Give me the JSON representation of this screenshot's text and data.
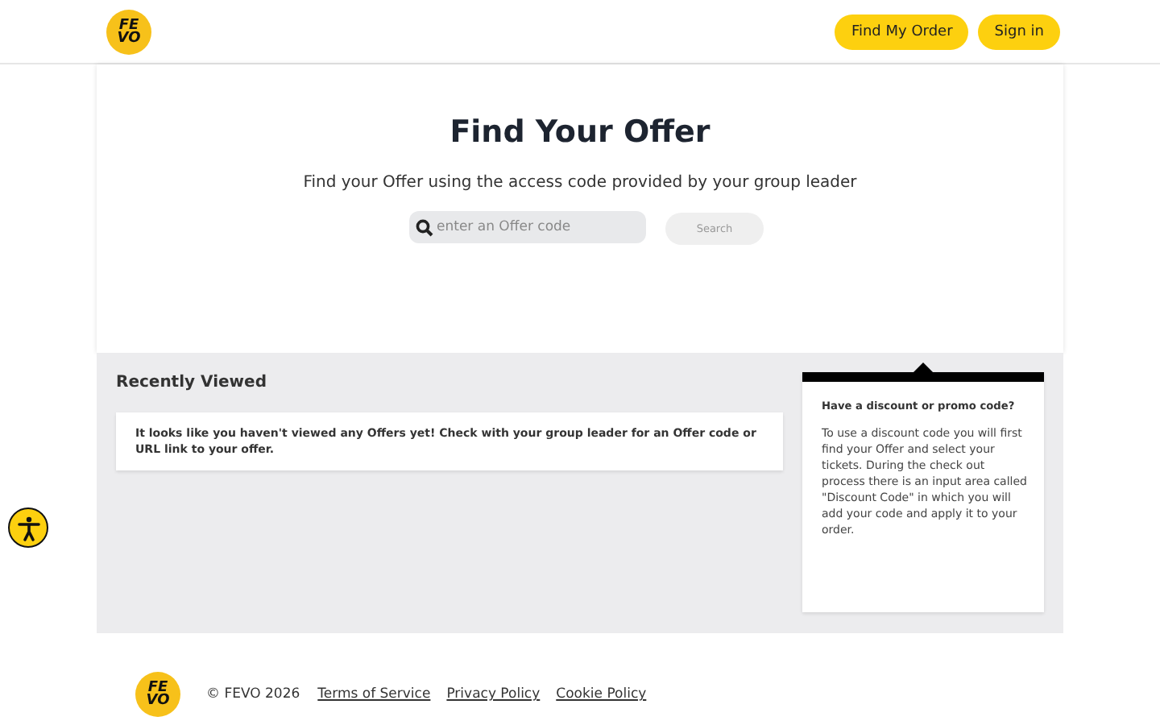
{
  "header": {
    "logo": [
      "FE",
      "VO"
    ],
    "buttons": [
      "Find My Order",
      "Sign in"
    ]
  },
  "hero": {
    "title": "Find Your Offer",
    "subtitle": "Find your Offer using the access code provided by your group leader",
    "search": {
      "placeholder": "enter an Offer code"
    },
    "search_button": {
      "label": "Search",
      "disabled": true
    }
  },
  "recently_viewed": {
    "title": "Recently Viewed",
    "message": "It looks like you haven't viewed any Offers yet! Check with your group leader for an Offer code or URL link to your offer."
  },
  "promo": {
    "title": "Have a discount or promo code?",
    "text": "To use a discount code you will first find your Offer and select your tickets. During the check out process there is an input area called \"Discount Code\" in which you will add your code and apply it to your order."
  },
  "footer": {
    "logo": [
      "FE",
      "VO"
    ],
    "copyright": "© FEVO 2026",
    "links": [
      "Terms of Service",
      "Privacy Policy",
      "Cookie Policy"
    ]
  }
}
